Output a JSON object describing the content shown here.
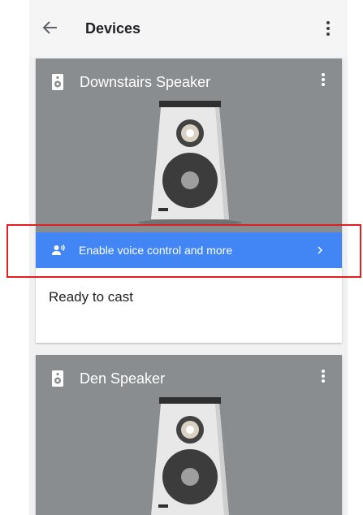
{
  "appbar": {
    "title": "Devices",
    "back_icon": "arrow-back-icon",
    "menu_icon": "more-vert-icon"
  },
  "devices": [
    {
      "name": "Downstairs  Speaker",
      "icon": "speaker-icon",
      "banner": {
        "label": "Enable voice control and more",
        "icon": "voice-person-icon",
        "chevron": "chevron-right-icon"
      },
      "status": "Ready to cast"
    },
    {
      "name": "Den Speaker",
      "icon": "speaker-icon"
    }
  ],
  "colors": {
    "hero_bg": "#8a8d8f",
    "banner_bg": "#4285f4",
    "highlight": "#e02020",
    "page_bg": "#f1f1f1"
  }
}
